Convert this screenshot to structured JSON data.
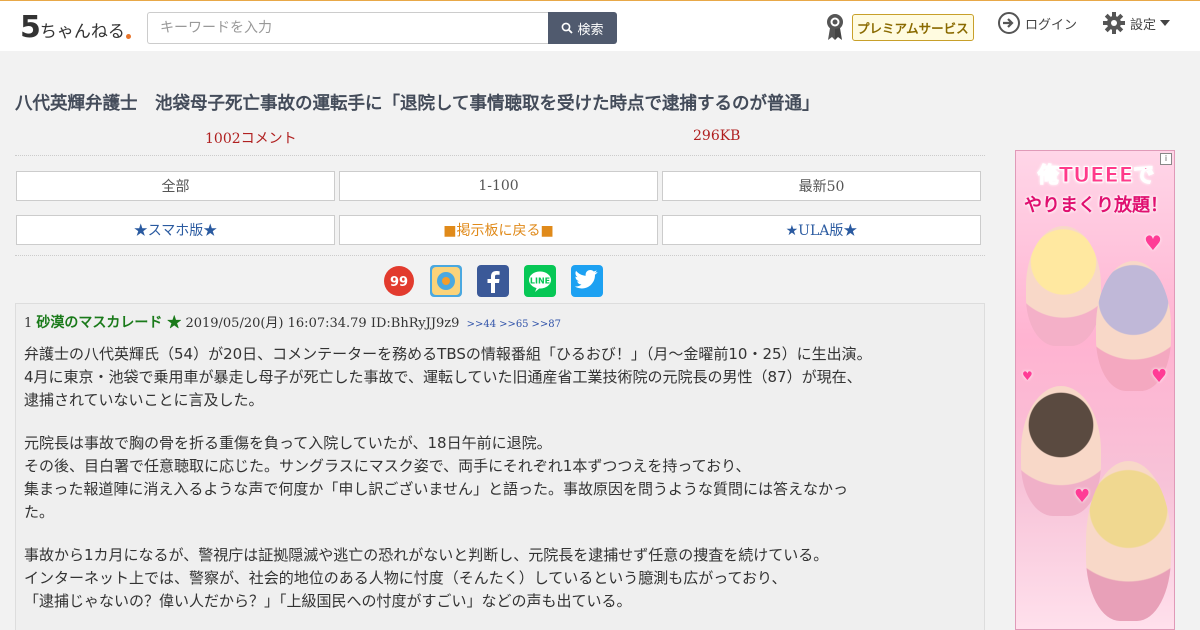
{
  "header": {
    "logo_text": "ちゃんねる",
    "search_placeholder": "キーワードを入力",
    "search_button": "検索",
    "premium_label": "プレミアムサービス",
    "login_label": "ログイン",
    "settings_label": "設定"
  },
  "thread": {
    "title": "八代英輝弁護士　池袋母子死亡事故の運転手に「退院して事情聴取を受けた時点で逮捕するのが普通」",
    "comment_count": "1002コメント",
    "size": "296KB"
  },
  "nav": {
    "all": "全部",
    "range": "1-100",
    "latest": "最新50",
    "smartphone": "★スマホ版★",
    "back": "■掲示板に戻る■",
    "ula": "★ULA版★"
  },
  "share": [
    "99-icon",
    "bookmark-icon",
    "facebook-icon",
    "line-icon",
    "twitter-icon"
  ],
  "post": {
    "number": "1",
    "name": "砂漠のマスカレード ★",
    "date": "2019/05/20(月) 16:07:34.79",
    "id": "ID:BhRyJJ9z9",
    "refs": [
      ">>44",
      ">>65",
      ">>87"
    ],
    "paragraphs": [
      [
        "弁護士の八代英輝氏（54）が20日、コメンテーターを務めるTBSの情報番組「ひるおび！」（月～金曜前10・25）に生出演。",
        "4月に東京・池袋で乗用車が暴走し母子が死亡した事故で、運転していた旧通産省工業技術院の元院長の男性（87）が現在、",
        "逮捕されていないことに言及した。"
      ],
      [
        "元院長は事故で胸の骨を折る重傷を負って入院していたが、18日午前に退院。",
        "その後、目白署で任意聴取に応じた。サングラスにマスク姿で、両手にそれぞれ1本ずつつえを持っており、",
        "集まった報道陣に消え入るような声で何度か「申し訳ございません」と語った。事故原因を問うような質問には答えなかっ",
        "た。"
      ],
      [
        "事故から1カ月になるが、警視庁は証拠隠滅や逃亡の恐れがないと判断し、元院長を逮捕せず任意の捜査を続けている。",
        "インターネット上では、警察が、社会的地位のある人物に忖度（そんたく）しているという臆測も広がっており、",
        "「逮捕じゃないの？偉い人だから？」「上級国民への忖度がすごい」などの声も出ている。"
      ]
    ]
  },
  "ad": {
    "line1": "俺TUEEEで",
    "line2": "やりまくり放題！"
  }
}
